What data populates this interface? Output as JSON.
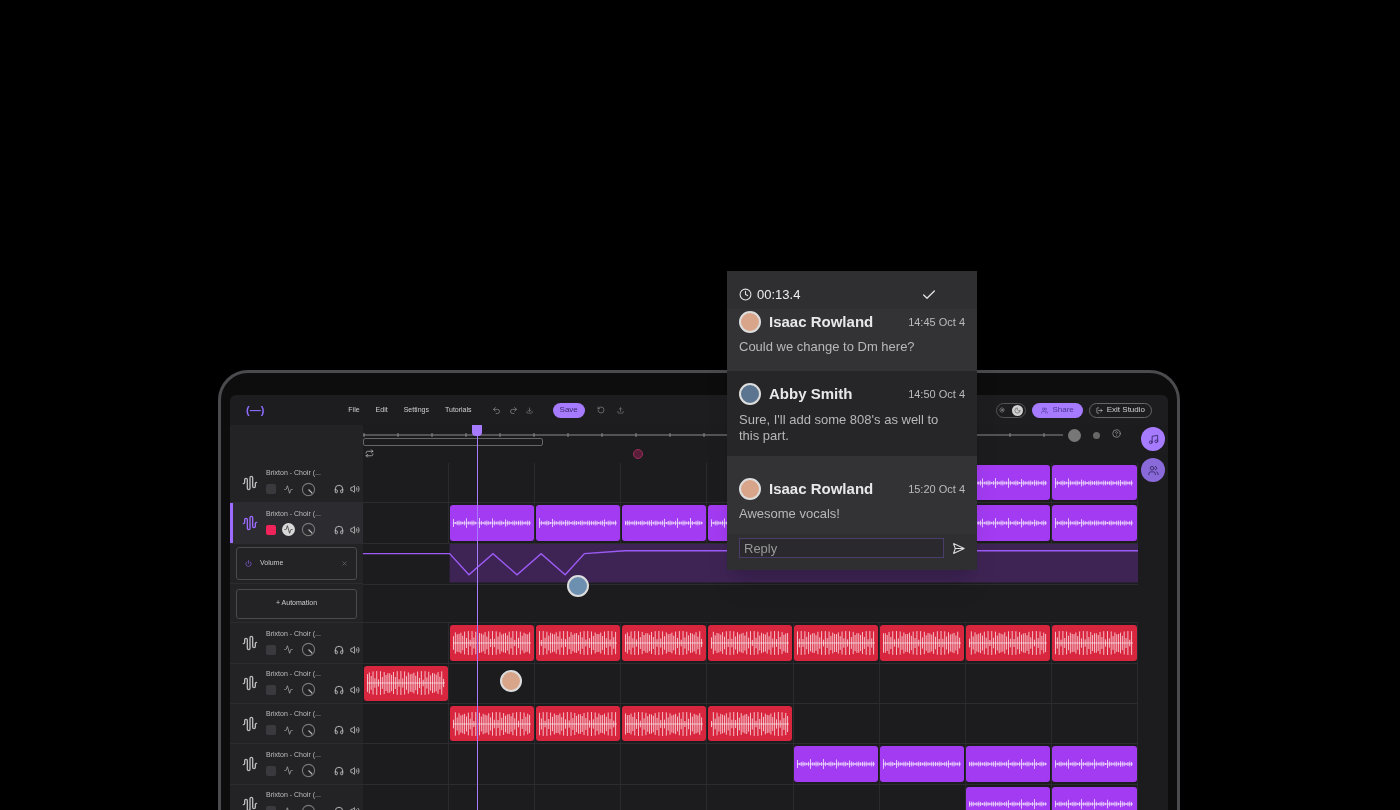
{
  "logo": "(—)",
  "menu": [
    "File",
    "Edit",
    "Settings",
    "Tutorials"
  ],
  "save_button": "Save",
  "dark_mode": true,
  "share_button": "Share",
  "exit_button": "Exit Studio",
  "playhead": {
    "level": 0.147
  },
  "tracks": [
    {
      "kind": "track",
      "name": "Brixton - Choir (...",
      "selected": false,
      "armed": false,
      "solo": false,
      "cells": [
        {
          "kind": "empty"
        },
        {
          "kind": "empty"
        },
        {
          "kind": "empty"
        },
        {
          "kind": "empty"
        },
        {
          "kind": "empty"
        },
        {
          "kind": "covered"
        },
        {
          "kind": "covered"
        },
        {
          "kind": "clip",
          "color": "#a33bf2"
        },
        {
          "kind": "clip",
          "color": "#a33bf2"
        }
      ]
    },
    {
      "kind": "track",
      "name": "Brixton - Choir (...",
      "selected": true,
      "armed": true,
      "solo": true,
      "cells": [
        {
          "kind": "empty"
        },
        {
          "kind": "clip",
          "color": "#a33bf2"
        },
        {
          "kind": "clip",
          "color": "#a33bf2"
        },
        {
          "kind": "clip",
          "color": "#a33bf2"
        },
        {
          "kind": "clip",
          "color": "#a33bf2"
        },
        {
          "kind": "covered"
        },
        {
          "kind": "covered"
        },
        {
          "kind": "clip",
          "color": "#a33bf2"
        },
        {
          "kind": "clip",
          "color": "#a33bf2"
        }
      ]
    },
    {
      "kind": "automation",
      "label": "Volume"
    },
    {
      "kind": "add_automation",
      "label": "+ Automation"
    },
    {
      "kind": "track",
      "name": "Brixton - Choir (...",
      "selected": false,
      "armed": false,
      "solo": false,
      "cells": [
        {
          "kind": "empty"
        },
        {
          "kind": "clip",
          "color": "#d9263f"
        },
        {
          "kind": "clip",
          "color": "#d9263f"
        },
        {
          "kind": "clip",
          "color": "#d9263f"
        },
        {
          "kind": "clip",
          "color": "#d9263f"
        },
        {
          "kind": "clip",
          "color": "#d9263f"
        },
        {
          "kind": "clip",
          "color": "#d9263f"
        },
        {
          "kind": "clip",
          "color": "#d9263f"
        },
        {
          "kind": "clip",
          "color": "#d9263f"
        }
      ]
    },
    {
      "kind": "track",
      "name": "Brixton - Choir (...",
      "selected": false,
      "armed": false,
      "solo": false,
      "cells": [
        {
          "kind": "clip",
          "color": "#d9263f"
        },
        {
          "kind": "empty"
        },
        {
          "kind": "empty"
        },
        {
          "kind": "empty"
        },
        {
          "kind": "empty"
        },
        {
          "kind": "empty"
        },
        {
          "kind": "empty"
        },
        {
          "kind": "empty"
        },
        {
          "kind": "empty"
        }
      ]
    },
    {
      "kind": "track",
      "name": "Brixton - Choir (...",
      "selected": false,
      "armed": false,
      "solo": false,
      "cells": [
        {
          "kind": "empty"
        },
        {
          "kind": "clip",
          "color": "#d9263f"
        },
        {
          "kind": "clip",
          "color": "#d9263f"
        },
        {
          "kind": "clip",
          "color": "#d9263f"
        },
        {
          "kind": "clip",
          "color": "#d9263f"
        },
        {
          "kind": "empty"
        },
        {
          "kind": "empty"
        },
        {
          "kind": "empty"
        },
        {
          "kind": "empty"
        }
      ]
    },
    {
      "kind": "track",
      "name": "Brixton - Choir (...",
      "selected": false,
      "armed": false,
      "solo": false,
      "cells": [
        {
          "kind": "empty"
        },
        {
          "kind": "empty"
        },
        {
          "kind": "empty"
        },
        {
          "kind": "empty"
        },
        {
          "kind": "empty"
        },
        {
          "kind": "clip",
          "color": "#a33bf2"
        },
        {
          "kind": "clip",
          "color": "#a33bf2"
        },
        {
          "kind": "clip",
          "color": "#a33bf2"
        },
        {
          "kind": "clip",
          "color": "#a33bf2"
        }
      ]
    },
    {
      "kind": "track",
      "name": "Brixton - Choir (...",
      "selected": false,
      "armed": false,
      "solo": false,
      "cells": [
        {
          "kind": "empty"
        },
        {
          "kind": "empty"
        },
        {
          "kind": "empty"
        },
        {
          "kind": "empty"
        },
        {
          "kind": "empty"
        },
        {
          "kind": "empty"
        },
        {
          "kind": "empty"
        },
        {
          "kind": "clip",
          "color": "#a33bf2"
        },
        {
          "kind": "clip",
          "color": "#a33bf2"
        }
      ]
    }
  ],
  "comment_thread": {
    "time": "00:13.4",
    "comments": [
      {
        "author": "Isaac Rowland",
        "time": "14:45 Oct 4",
        "text": "Could we change to Dm here?",
        "selected": false
      },
      {
        "author": "Abby Smith",
        "time": "14:50 Oct 4",
        "text": "Sure, I'll add some 808's as well to this part.",
        "selected": true
      },
      {
        "author": "Isaac Rowland",
        "time": "15:20 Oct 4",
        "text": "Awesome vocals!",
        "selected": false
      }
    ],
    "reply": {
      "placeholder": "Reply"
    }
  }
}
